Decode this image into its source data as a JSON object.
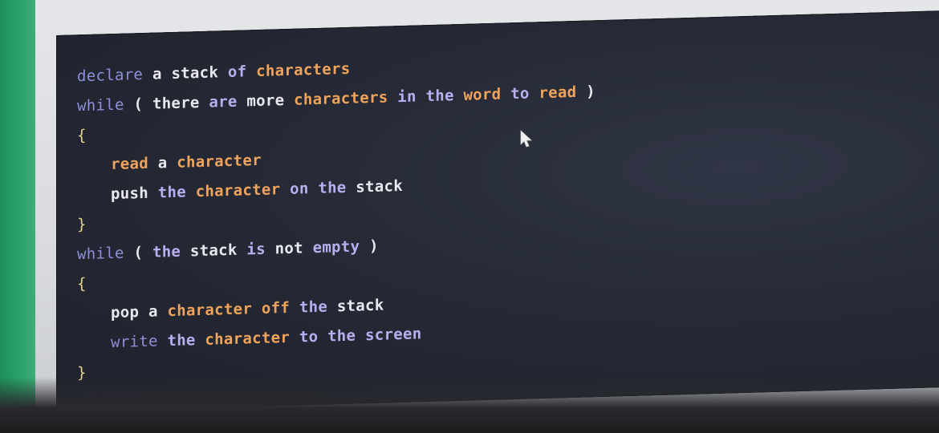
{
  "code_lines": [
    {
      "tokens": [
        {
          "t": "declare",
          "c": "kw-blue"
        },
        {
          "t": " ",
          "c": ""
        },
        {
          "t": "a",
          "c": "kw-white"
        },
        {
          "t": " ",
          "c": ""
        },
        {
          "t": "stack",
          "c": "kw-white"
        },
        {
          "t": " ",
          "c": ""
        },
        {
          "t": "of",
          "c": "kw-lilac"
        },
        {
          "t": " ",
          "c": ""
        },
        {
          "t": "characters",
          "c": "kw-orange"
        }
      ]
    },
    {
      "tokens": [
        {
          "t": "while",
          "c": "kw-blue"
        },
        {
          "t": " ",
          "c": ""
        },
        {
          "t": "(",
          "c": "kw-white"
        },
        {
          "t": " ",
          "c": ""
        },
        {
          "t": "there",
          "c": "kw-white"
        },
        {
          "t": " ",
          "c": ""
        },
        {
          "t": "are",
          "c": "kw-lilac"
        },
        {
          "t": " ",
          "c": ""
        },
        {
          "t": "more",
          "c": "kw-white"
        },
        {
          "t": " ",
          "c": ""
        },
        {
          "t": "characters",
          "c": "kw-orange"
        },
        {
          "t": " ",
          "c": ""
        },
        {
          "t": "in",
          "c": "kw-lilac"
        },
        {
          "t": " ",
          "c": ""
        },
        {
          "t": "the",
          "c": "kw-lilac"
        },
        {
          "t": " ",
          "c": ""
        },
        {
          "t": "word",
          "c": "kw-orange"
        },
        {
          "t": " ",
          "c": ""
        },
        {
          "t": "to",
          "c": "kw-lilac"
        },
        {
          "t": " ",
          "c": ""
        },
        {
          "t": "read",
          "c": "kw-orange"
        },
        {
          "t": " ",
          "c": ""
        },
        {
          "t": ")",
          "c": "kw-white"
        }
      ]
    },
    {
      "tokens": [
        {
          "t": "{",
          "c": "brace"
        }
      ]
    },
    {
      "indent": true,
      "tokens": [
        {
          "t": "read",
          "c": "kw-orange"
        },
        {
          "t": " ",
          "c": ""
        },
        {
          "t": "a",
          "c": "kw-white"
        },
        {
          "t": " ",
          "c": ""
        },
        {
          "t": "character",
          "c": "kw-orange"
        }
      ]
    },
    {
      "indent": true,
      "tokens": [
        {
          "t": "push",
          "c": "kw-white"
        },
        {
          "t": " ",
          "c": ""
        },
        {
          "t": "the",
          "c": "kw-lilac"
        },
        {
          "t": " ",
          "c": ""
        },
        {
          "t": "character",
          "c": "kw-orange"
        },
        {
          "t": " ",
          "c": ""
        },
        {
          "t": "on",
          "c": "kw-lilac"
        },
        {
          "t": " ",
          "c": ""
        },
        {
          "t": "the",
          "c": "kw-lilac"
        },
        {
          "t": " ",
          "c": ""
        },
        {
          "t": "stack",
          "c": "kw-white"
        }
      ]
    },
    {
      "tokens": [
        {
          "t": "}",
          "c": "brace"
        }
      ]
    },
    {
      "tokens": [
        {
          "t": "while",
          "c": "kw-blue"
        },
        {
          "t": " ",
          "c": ""
        },
        {
          "t": "(",
          "c": "kw-white"
        },
        {
          "t": " ",
          "c": ""
        },
        {
          "t": "the",
          "c": "kw-lilac"
        },
        {
          "t": " ",
          "c": ""
        },
        {
          "t": "stack",
          "c": "kw-white"
        },
        {
          "t": " ",
          "c": ""
        },
        {
          "t": "is",
          "c": "kw-lilac"
        },
        {
          "t": " ",
          "c": ""
        },
        {
          "t": "not",
          "c": "kw-white"
        },
        {
          "t": " ",
          "c": ""
        },
        {
          "t": "empty",
          "c": "kw-lilac"
        },
        {
          "t": " ",
          "c": ""
        },
        {
          "t": ")",
          "c": "kw-white"
        }
      ]
    },
    {
      "tokens": [
        {
          "t": "{",
          "c": "brace"
        }
      ]
    },
    {
      "indent": true,
      "tokens": [
        {
          "t": "pop",
          "c": "kw-white"
        },
        {
          "t": " ",
          "c": ""
        },
        {
          "t": "a",
          "c": "kw-white"
        },
        {
          "t": " ",
          "c": ""
        },
        {
          "t": "character",
          "c": "kw-orange"
        },
        {
          "t": " ",
          "c": ""
        },
        {
          "t": "off",
          "c": "kw-orange"
        },
        {
          "t": " ",
          "c": ""
        },
        {
          "t": "the",
          "c": "kw-lilac"
        },
        {
          "t": " ",
          "c": ""
        },
        {
          "t": "stack",
          "c": "kw-white"
        }
      ]
    },
    {
      "indent": true,
      "tokens": [
        {
          "t": "write",
          "c": "kw-blue"
        },
        {
          "t": " ",
          "c": ""
        },
        {
          "t": "the",
          "c": "kw-lilac"
        },
        {
          "t": " ",
          "c": ""
        },
        {
          "t": "character",
          "c": "kw-orange"
        },
        {
          "t": " ",
          "c": ""
        },
        {
          "t": "to",
          "c": "kw-lilac"
        },
        {
          "t": " ",
          "c": ""
        },
        {
          "t": "the",
          "c": "kw-lilac"
        },
        {
          "t": " ",
          "c": ""
        },
        {
          "t": "screen",
          "c": "kw-lilac"
        }
      ]
    },
    {
      "tokens": [
        {
          "t": "}",
          "c": "brace"
        }
      ]
    }
  ],
  "cursor": {
    "icon": "mouse-pointer-icon"
  },
  "colors": {
    "background": "#262a36",
    "keyword_blue": "#8f8fd8",
    "keyword_lilac": "#b8aef0",
    "text_white": "#e8e8ee",
    "keyword_orange": "#f0a35a",
    "brace": "#e8d28a"
  }
}
